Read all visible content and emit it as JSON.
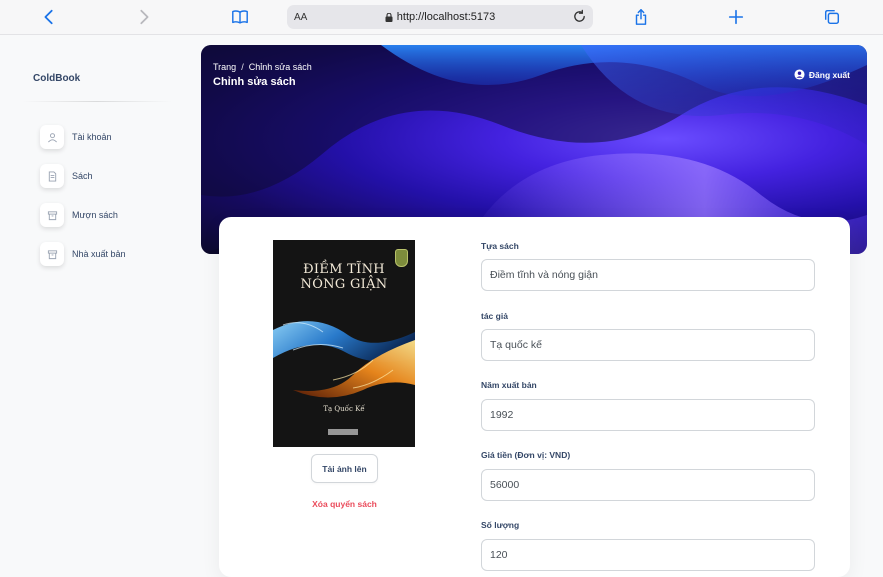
{
  "browser": {
    "aa_label": "AA",
    "url": "http://localhost:5173",
    "icons": [
      "chevron-left-icon",
      "chevron-right-icon",
      "book-icon",
      "lock-icon",
      "reload-icon",
      "share-icon",
      "plus-icon",
      "tabs-icon"
    ]
  },
  "sidebar": {
    "brand": "ColdBook",
    "items": [
      {
        "label": "Tài khoản",
        "icon": "user-icon"
      },
      {
        "label": "Sách",
        "icon": "document-icon"
      },
      {
        "label": "Mượn sách",
        "icon": "archive-icon"
      },
      {
        "label": "Nhà xuất bản",
        "icon": "archive-icon"
      }
    ]
  },
  "header": {
    "breadcrumb_root": "Trang",
    "breadcrumb_separator": "/",
    "breadcrumb_current": "Chỉnh sửa sách",
    "title": "Chỉnh sửa sách",
    "logout_label": "Đăng xuất"
  },
  "book": {
    "cover_title_line1": "ĐIỀM TĨNH",
    "cover_title_line2": "NÓNG GIẬN",
    "cover_author": "Tạ Quốc Kế",
    "upload_label": "Tải ảnh lên",
    "delete_label": "Xóa quyển sách"
  },
  "form": {
    "title_label": "Tựa sách",
    "title_value": "Điềm tĩnh và nóng giận",
    "author_label": "tác giả",
    "author_value": "Tạ quốc kế",
    "year_label": "Năm xuất bản",
    "year_value": "1992",
    "price_label": "Giá tiền (Đơn vị: VND)",
    "price_value": "56000",
    "quantity_label": "Số lượng",
    "quantity_value": "120"
  },
  "colors": {
    "accent": "#1a73e8",
    "danger": "#ea4c5c",
    "text": "#344767",
    "banner_dark": "#0c0a2c",
    "banner_purple": "#4422e0"
  }
}
